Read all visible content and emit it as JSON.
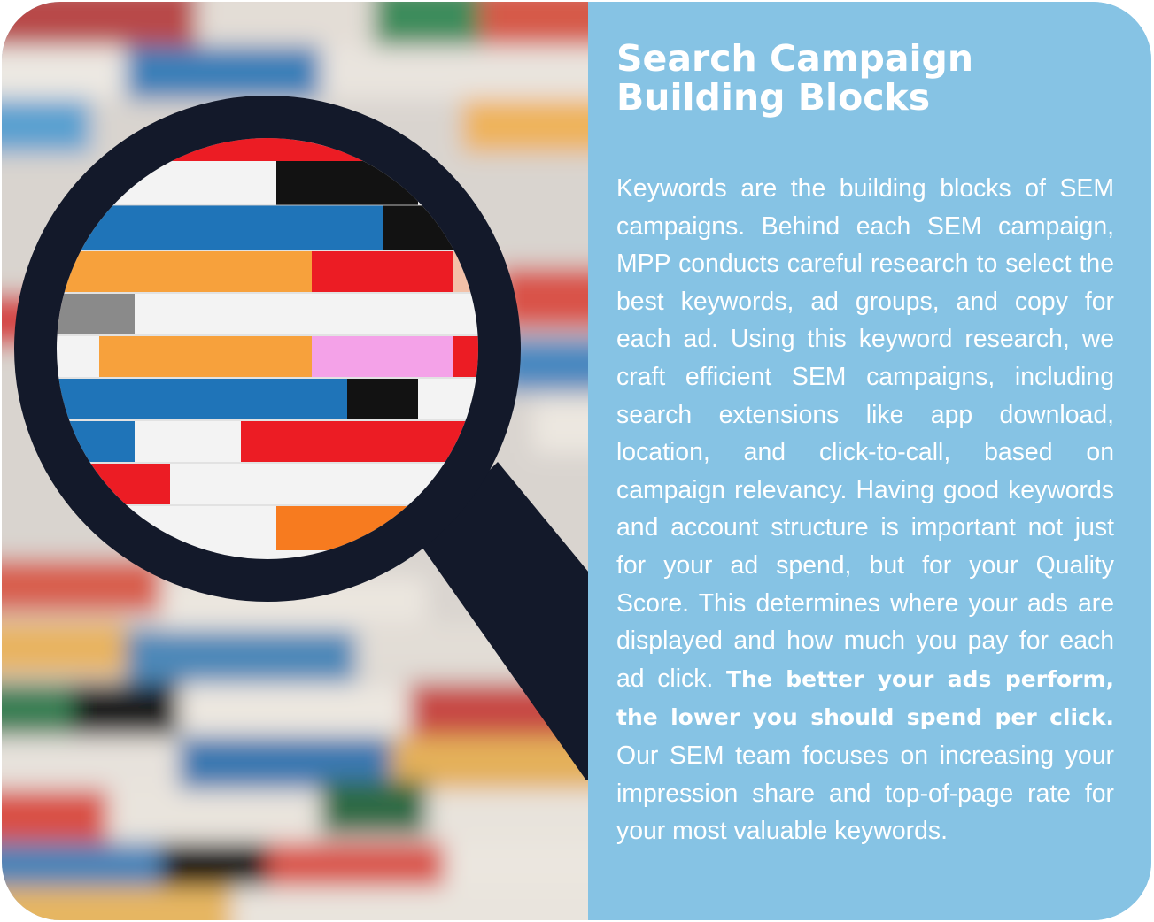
{
  "photo": {
    "subject": "magnifier-icon"
  },
  "title": {
    "line1": "Search Campaign",
    "line2": "Building Blocks"
  },
  "body": {
    "part1": "Keywords are the building blocks of SEM campaigns. Behind each SEM campaign, MPP conducts careful research to select the best keywords, ad groups, and copy for each ad. Using this keyword research, we craft efficient SEM campaigns, including search extensions like app download, location, and click-to-call, based on campaign relevancy. Having good keywords and account structure is important not just for your ad spend, but for your Quality Score. This determines where your ads are displayed and how much you pay for each ad click. ",
    "bold": "The better your ads perform, the lower you should spend per click.",
    "part2": " Our SEM team focuses on increasing your impression share and top-of-page rate for your most valuable keywords."
  },
  "colors": {
    "panel": "#86c3e4",
    "text": "#ffffff",
    "brick_red": "#ec1c24",
    "brick_blue": "#1f74b8",
    "brick_orange": "#f7a13c",
    "brick_pink": "#f4a2e8",
    "brick_black": "#121212",
    "brick_white": "#f3f3f3",
    "lens_frame": "#13192a"
  }
}
